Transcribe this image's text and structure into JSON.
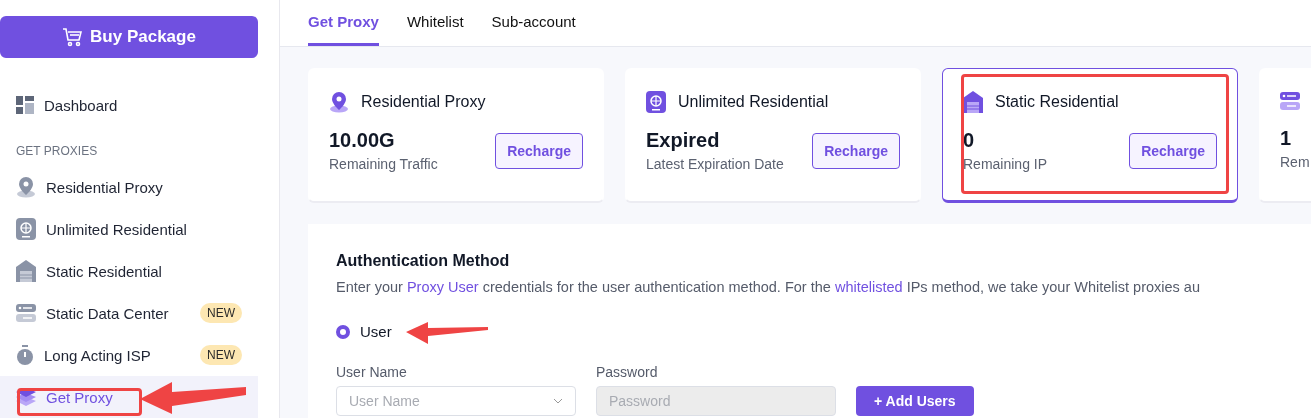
{
  "sidebar": {
    "buy_button": "Buy Package",
    "items": [
      {
        "label": "Dashboard",
        "kind": "dashboard",
        "selected": false
      }
    ],
    "section_title": "GET PROXIES",
    "proxy_items": [
      {
        "label": "Residential Proxy",
        "kind": "pin",
        "selected": false
      },
      {
        "label": "Unlimited Residential",
        "kind": "globe",
        "selected": false
      },
      {
        "label": "Static Residential",
        "kind": "house",
        "selected": false
      },
      {
        "label": "Static Data Center",
        "kind": "server",
        "badge": "NEW",
        "selected": false
      },
      {
        "label": "Long Acting ISP",
        "kind": "timer",
        "badge": "NEW",
        "selected": false
      },
      {
        "label": "Get Proxy",
        "kind": "layers",
        "selected": true
      }
    ]
  },
  "tabs": [
    {
      "label": "Get Proxy",
      "selected": true
    },
    {
      "label": "Whitelist",
      "selected": false
    },
    {
      "label": "Sub-account",
      "selected": false
    }
  ],
  "cards": [
    {
      "title": "Residential Proxy",
      "kind": "pin",
      "value": "10.00G",
      "caption": "Remaining Traffic",
      "button": "Recharge",
      "selected": false
    },
    {
      "title": "Unlimited Residential",
      "kind": "globe",
      "value": "Expired",
      "caption": "Latest Expiration Date",
      "button": "Recharge",
      "selected": false
    },
    {
      "title": "Static Residential",
      "kind": "house",
      "value": "0",
      "caption": "Remaining IP",
      "button": "Recharge",
      "selected": true
    },
    {
      "kind": "server",
      "value": "1",
      "caption": "Rem",
      "selected": false
    }
  ],
  "auth": {
    "title": "Authentication Method",
    "description": "Enter your **Proxy User** credentials for the user authentication method. For the **whitelisted** IPs method, we take your Whitelist proxies au",
    "options": [
      {
        "label": "User",
        "selected": true
      }
    ],
    "fields": [
      {
        "label": "User Name",
        "placeholder": "User Name",
        "kind": "select",
        "disabled": false
      },
      {
        "label": "Password",
        "placeholder": "Password",
        "kind": "text",
        "disabled": true
      }
    ],
    "add_button": "+ Add Users"
  }
}
